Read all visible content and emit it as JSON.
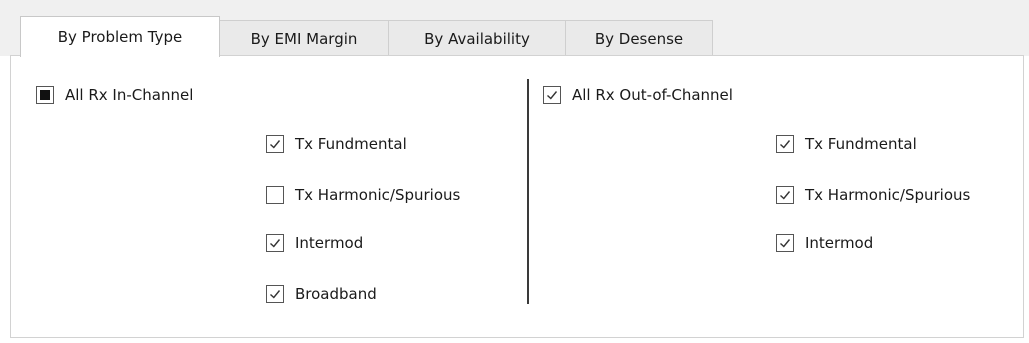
{
  "tabs": [
    {
      "label": "By Problem Type",
      "active": true
    },
    {
      "label": "By EMI Margin",
      "active": false
    },
    {
      "label": "By Availability",
      "active": false
    },
    {
      "label": "By Desense",
      "active": false
    }
  ],
  "in_channel": {
    "label": "All Rx In-Channel",
    "state": "indeterminate",
    "items": [
      {
        "label": "Tx Fundmental",
        "checked": true
      },
      {
        "label": "Tx Harmonic/Spurious",
        "checked": false
      },
      {
        "label": "Intermod",
        "checked": true
      },
      {
        "label": "Broadband",
        "checked": true
      }
    ]
  },
  "out_channel": {
    "label": "All Rx Out-of-Channel",
    "state": "checked",
    "items": [
      {
        "label": "Tx Fundmental",
        "checked": true
      },
      {
        "label": "Tx Harmonic/Spurious",
        "checked": true
      },
      {
        "label": "Intermod",
        "checked": true
      }
    ]
  },
  "colors": {
    "panel_bg": "#ffffff",
    "tabstrip_bg": "#f0f0f0",
    "check": "#333333"
  }
}
